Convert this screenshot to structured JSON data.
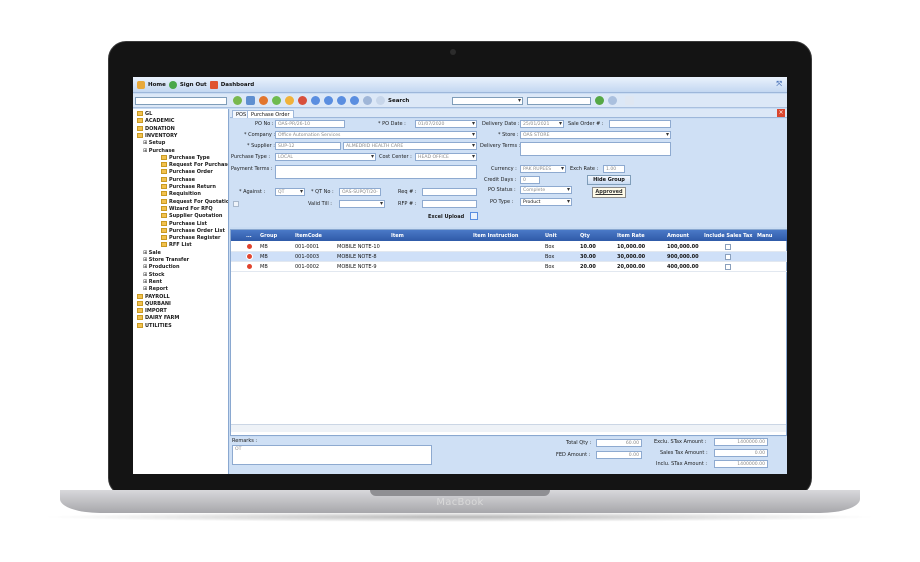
{
  "device": {
    "brand": "MacBook"
  },
  "topbar": {
    "home": "Home",
    "signout": "Sign Out",
    "dashboard": "Dashboard"
  },
  "toolbar": {
    "search_label": "Search"
  },
  "tree": [
    {
      "label": "GL",
      "level": 0,
      "folder": true
    },
    {
      "label": "ACADEMIC",
      "level": 0,
      "folder": true
    },
    {
      "label": "DONATION",
      "level": 0,
      "folder": true
    },
    {
      "label": "INVENTORY",
      "level": 0,
      "folder": true
    },
    {
      "label": "Setup",
      "level": 1,
      "folder": false
    },
    {
      "label": "Purchase",
      "level": 1,
      "folder": false
    },
    {
      "label": "Purchase Type",
      "level": 2,
      "folder": true
    },
    {
      "label": "Request For Purchase",
      "level": 2,
      "folder": true
    },
    {
      "label": "Purchase Order",
      "level": 2,
      "folder": true
    },
    {
      "label": "Purchase",
      "level": 2,
      "folder": true
    },
    {
      "label": "Purchase Return",
      "level": 2,
      "folder": true
    },
    {
      "label": "Requisition",
      "level": 2,
      "folder": true
    },
    {
      "label": "Request For Quotation",
      "level": 2,
      "folder": true
    },
    {
      "label": "Wizard For RFQ",
      "level": 2,
      "folder": true
    },
    {
      "label": "Supplier Quotation",
      "level": 2,
      "folder": true
    },
    {
      "label": "Purchase List",
      "level": 2,
      "folder": true
    },
    {
      "label": "Purchase Order List",
      "level": 2,
      "folder": true
    },
    {
      "label": "Purchase Register",
      "level": 2,
      "folder": true
    },
    {
      "label": "RFF List",
      "level": 2,
      "folder": true
    },
    {
      "label": "Sale",
      "level": 1,
      "folder": false
    },
    {
      "label": "Store Transfer",
      "level": 1,
      "folder": false
    },
    {
      "label": "Production",
      "level": 1,
      "folder": false
    },
    {
      "label": "Stock",
      "level": 1,
      "folder": false
    },
    {
      "label": "Rent",
      "level": 1,
      "folder": false
    },
    {
      "label": "Report",
      "level": 1,
      "folder": false
    },
    {
      "label": "PAYROLL",
      "level": 0,
      "folder": true
    },
    {
      "label": "QURBANI",
      "level": 0,
      "folder": true
    },
    {
      "label": "IMPORT",
      "level": 0,
      "folder": true
    },
    {
      "label": "DAIRY FARM",
      "level": 0,
      "folder": true
    },
    {
      "label": "UTILITIES",
      "level": 0,
      "folder": true
    }
  ],
  "tabs": [
    {
      "label": "POS"
    },
    {
      "label": "Purchase Order"
    }
  ],
  "form": {
    "po_no_label": "PO No :",
    "po_no": "OAS-PR/26-10",
    "po_date_label": "* PO Date :",
    "po_date": "01/07/2020",
    "delivery_date_label": "Delivery Date :",
    "delivery_date": "25/01/2021",
    "sale_order_label": "Sale Order # :",
    "company_label": "* Company :",
    "company": "Office Automation Services",
    "store_label": "* Store :",
    "store": "OAS STORE",
    "supplier_label": "* Supplier :",
    "supplier_code": "SUP-12",
    "supplier_name": "ALMEDRID HEALTH CARE",
    "delivery_terms_label": "Delivery Terms :",
    "purchase_type_label": "Purchase Type :",
    "purchase_type": "LOCAL",
    "cost_center_label": "Cost Center :",
    "cost_center": "HEAD OFFICE",
    "payment_terms_label": "Payment Terms :",
    "currency_label": "Currency :",
    "currency": "PAK RUPEES",
    "exch_rate_label": "Exch Rate :",
    "exch_rate": "1.00",
    "credit_days_label": "Credit Days :",
    "credit_days": "0",
    "hide_group": "Hide Group",
    "po_status_label": "PO Status :",
    "po_status": "Complete",
    "approved": "Approved",
    "against_label": "* Against :",
    "against": "QT",
    "qt_no_label": "* QT No :",
    "qt_no": "OAS-SUPQT/20-",
    "req_label": "Req # :",
    "valid_till_label": "Valid Till :",
    "rfp_label": "RFP # :",
    "po_type_label": "PO Type :",
    "po_type": "Product",
    "excel_upload": "Excel Upload"
  },
  "grid": {
    "headers": [
      "...",
      "Group",
      "ItemCode",
      "Item",
      "Item Instruction",
      "Unit",
      "Qty",
      "Item Rate",
      "Amount",
      "Include Sales Tax",
      "Manu"
    ],
    "rows": [
      {
        "group": "MB",
        "code": "001-0001",
        "item": "MOBILE NOTE-10",
        "unit": "Box",
        "qty": "10.00",
        "rate": "10,000.00",
        "amount": "100,000.00"
      },
      {
        "group": "MB",
        "code": "001-0003",
        "item": "MOBILE NOTE-8",
        "unit": "Box",
        "qty": "30.00",
        "rate": "30,000.00",
        "amount": "900,000.00"
      },
      {
        "group": "MB",
        "code": "001-0002",
        "item": "MOBILE NOTE-9",
        "unit": "Box",
        "qty": "20.00",
        "rate": "20,000.00",
        "amount": "400,000.00"
      }
    ]
  },
  "footer": {
    "remarks_label": "Remarks :",
    "remarks": "OT",
    "total_qty_label": "Total Qty :",
    "total_qty": "60.00",
    "fed_amount_label": "FED Amount :",
    "fed_amount": "0.00",
    "exclu_label": "Exclu. STax Amount :",
    "exclu": "1400000.00",
    "sales_tax_label": "Sales Tax Amount :",
    "sales_tax": "0.00",
    "inclu_label": "Inclu. STax Amount :",
    "inclu": "1400000.00"
  }
}
